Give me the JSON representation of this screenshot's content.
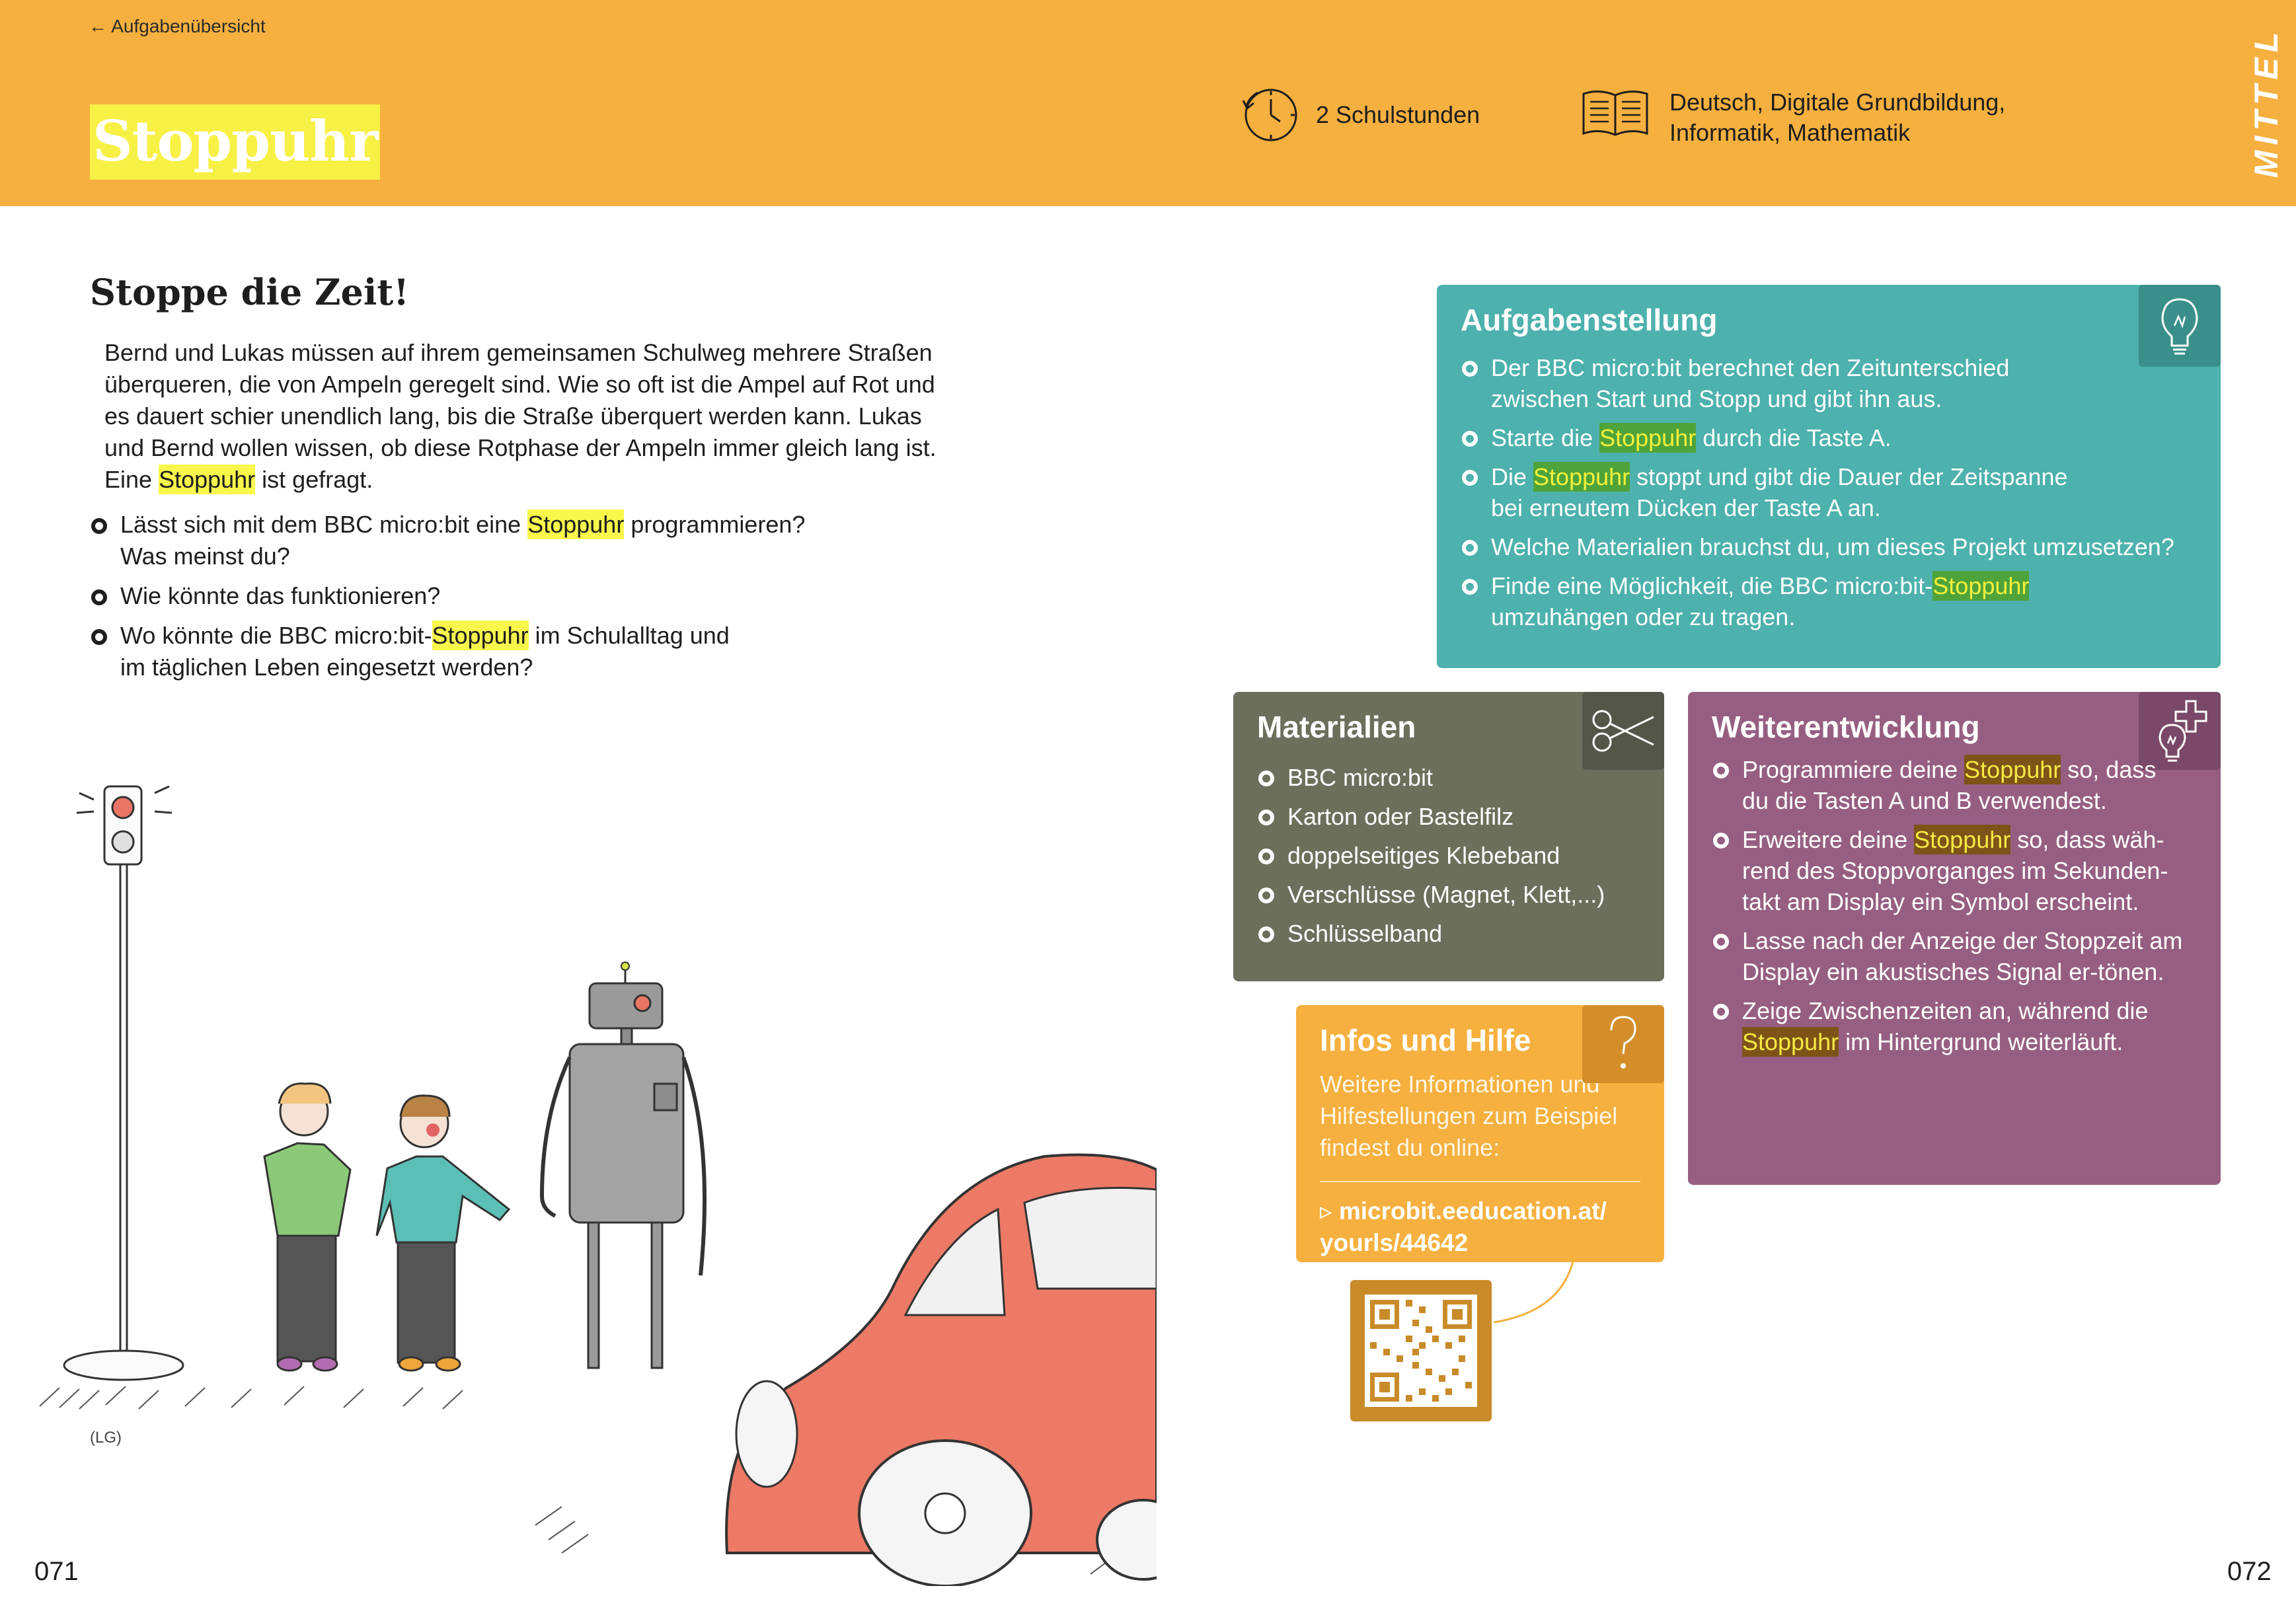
{
  "header": {
    "back_link": "← Aufgabenübersicht",
    "title": "Stoppuhr",
    "duration": "2 Schulstunden",
    "subjects_line1": "Deutsch, Digitale Grundbildung,",
    "subjects_line2": "Informatik, Mathematik",
    "level": "MITTEL"
  },
  "intro": {
    "heading": "Stoppe die Zeit!",
    "text_before": "Bernd und Lukas müssen auf ihrem gemeinsamen Schulweg mehrere Straßen überqueren, die von Ampeln geregelt sind. Wie so oft ist die Ampel auf Rot und es dauert schier unendlich lang, bis die Straße überquert werden kann. Lukas und Bernd wollen wissen, ob diese Rotphase der Ampeln immer gleich lang ist. Eine ",
    "text_highlight": "Stoppuhr",
    "text_after": " ist gefragt.",
    "questions": [
      {
        "before": "Lässt sich mit dem BBC micro:bit eine ",
        "hl": "Stoppuhr",
        "after": " programmieren? Was meinst du?"
      },
      {
        "before": "Wie könnte das funktionieren?",
        "hl": "",
        "after": ""
      },
      {
        "before": "Wo könnte die BBC micro:bit-",
        "hl": "Stoppuhr",
        "after": " im Schulalltag und im täglichen Leben eingesetzt werden?"
      }
    ]
  },
  "illustration": {
    "credit": "(LG)"
  },
  "aufgabe": {
    "title": "Aufgabenstellung",
    "icon": "lightbulb-icon",
    "items": [
      {
        "before": "Der BBC micro:bit berechnet den Zeitunterschied zwischen Start und Stopp und gibt ihn aus.",
        "hl": "",
        "after": ""
      },
      {
        "before": "Starte die ",
        "hl": "Stoppuhr",
        "after": " durch die Taste A."
      },
      {
        "before": "Die ",
        "hl": "Stoppuhr",
        "after": " stoppt und gibt die Dauer der Zeitspanne bei erneutem Dücken der Taste A an."
      },
      {
        "before": "Welche Materialien brauchst du, um dieses Projekt umzusetzen?",
        "hl": "",
        "after": ""
      },
      {
        "before": "Finde eine Möglichkeit, die BBC micro:bit-",
        "hl": "Stoppuhr",
        "after": " umzuhängen oder zu tragen."
      }
    ]
  },
  "materialien": {
    "title": "Materialien",
    "icon": "scissors-icon",
    "items": [
      "BBC micro:bit",
      "Karton oder Bastelfilz",
      "doppelseitiges Klebeband",
      "Verschlüsse (Magnet, Klett,...)",
      "Schlüsselband"
    ]
  },
  "weiter": {
    "title": "Weiterentwicklung",
    "icon": "lightbulb-plus-icon",
    "items": [
      {
        "before": "Programmiere deine ",
        "hl": "Stoppuhr",
        "after": " so, dass du die Tasten A und B verwendest."
      },
      {
        "before": "Erweitere deine ",
        "hl": "Stoppuhr",
        "after": " so, dass wäh-rend des Stoppvorganges im Sekunden-takt am Display ein Symbol erscheint."
      },
      {
        "before": "Lasse nach der Anzeige der Stoppzeit am Display ein akustisches Signal er-tönen.",
        "hl": "",
        "after": ""
      },
      {
        "before": "Zeige Zwischenzeiten an, während die ",
        "hl": "Stoppuhr",
        "after": " im Hintergrund weiterläuft."
      }
    ]
  },
  "infos": {
    "title": "Infos und Hilfe",
    "icon": "question-mark-icon",
    "description": "Weitere Informationen und Hilfestellungen zum Beispiel findest du online:",
    "link": "▹ microbit.eeducation.at/ yourls/44642"
  },
  "page_numbers": {
    "left": "071",
    "right": "072"
  },
  "colors": {
    "header": "#f6b03f",
    "aufgabe": "#4db1ad",
    "materialien": "#6d6f5d",
    "weiter": "#965f82",
    "infos": "#f6b03f",
    "highlight": "#f8f74c"
  }
}
